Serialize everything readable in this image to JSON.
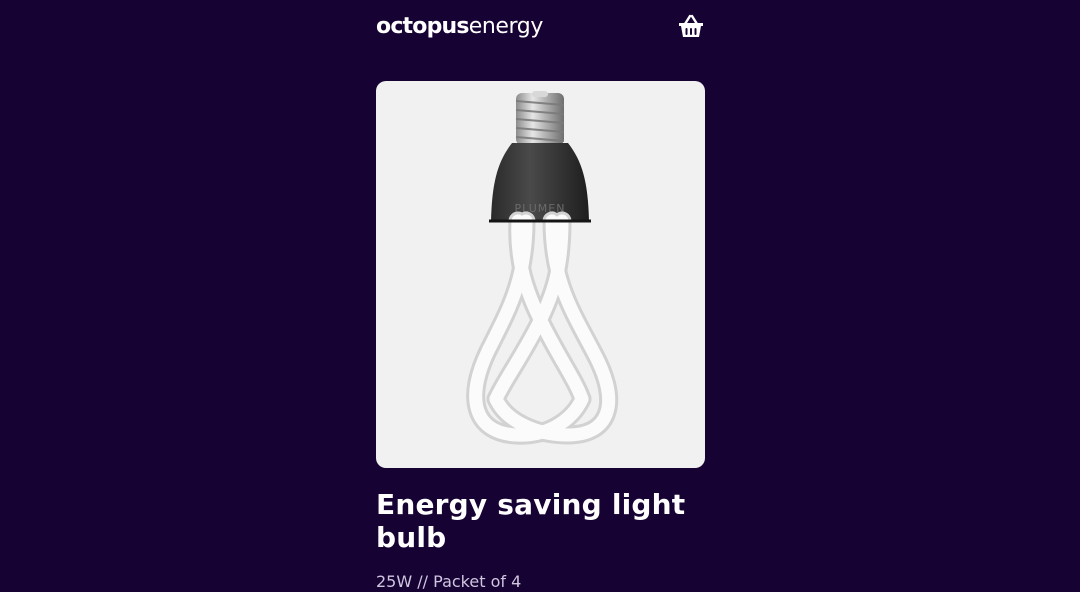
{
  "header": {
    "logo_bold": "octopus",
    "logo_light": "energy",
    "basket_icon": "basket-icon"
  },
  "product": {
    "image_icon": "light-bulb-image",
    "brand_mark": "PLUMEN",
    "title": "Energy saving light bulb",
    "subtitle": "25W // Packet of 4"
  },
  "colors": {
    "background": "#160233",
    "image_background": "#f1f1f1",
    "text": "#ffffff",
    "subtitle": "#cfc6df"
  }
}
